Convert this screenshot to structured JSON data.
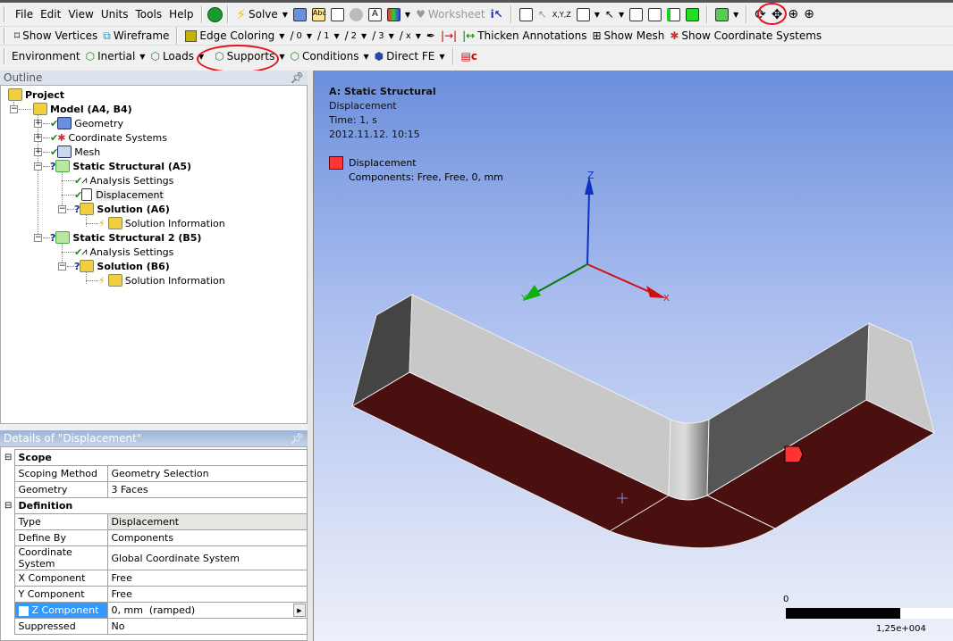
{
  "menu": [
    "File",
    "Edit",
    "View",
    "Units",
    "Tools",
    "Help"
  ],
  "toolbar1": {
    "solve": "Solve",
    "worksheet": "Worksheet"
  },
  "toolbar2": {
    "show_vertices": "Show Vertices",
    "wireframe": "Wireframe",
    "edge_coloring": "Edge Coloring",
    "edge_labels": [
      "0",
      "1",
      "2",
      "3",
      "x"
    ],
    "thicken": "Thicken Annotations",
    "show_mesh": "Show Mesh",
    "show_cs": "Show Coordinate Systems"
  },
  "toolbar3": {
    "environment": "Environment",
    "inertial": "Inertial",
    "loads": "Loads",
    "supports": "Supports",
    "conditions": "Conditions",
    "direct_fe": "Direct FE"
  },
  "outline": {
    "title": "Outline",
    "items": [
      "Project",
      "Model (A4, B4)",
      "Geometry",
      "Coordinate Systems",
      "Mesh",
      "Static Structural (A5)",
      "Analysis Settings",
      "Displacement",
      "Solution (A6)",
      "Solution Information",
      "Static Structural 2 (B5)",
      "Analysis Settings",
      "Solution (B6)",
      "Solution Information"
    ]
  },
  "details": {
    "title": "Details of \"Displacement\"",
    "groups": [
      {
        "name": "Scope",
        "rows": [
          [
            "Scoping Method",
            "Geometry Selection"
          ],
          [
            "Geometry",
            "3 Faces"
          ]
        ]
      },
      {
        "name": "Definition",
        "rows": [
          [
            "Type",
            "Displacement"
          ],
          [
            "Define By",
            "Components"
          ],
          [
            "Coordinate System",
            "Global Coordinate System"
          ],
          [
            "X Component",
            "Free"
          ],
          [
            "Y Component",
            "Free"
          ],
          [
            "Z Component",
            "0, mm  (ramped)"
          ],
          [
            "Suppressed",
            "No"
          ]
        ]
      }
    ]
  },
  "viewport": {
    "analysis": "A: Static Structural",
    "object": "Displacement",
    "time": "Time: 1, s",
    "date": "2012.11.12. 10:15",
    "legend_label": "Displacement",
    "legend_detail": "Components: Free, Free, 0, mm",
    "axes": {
      "x": "X",
      "y": "Y",
      "z": "Z"
    },
    "scale_min": "0",
    "scale_max": "1,25e+004"
  },
  "colors": {
    "face_selected": "#4a1010",
    "marker": "#ff3333",
    "highlight_oval": "#e0141e",
    "selected_row": "#3399ff"
  }
}
